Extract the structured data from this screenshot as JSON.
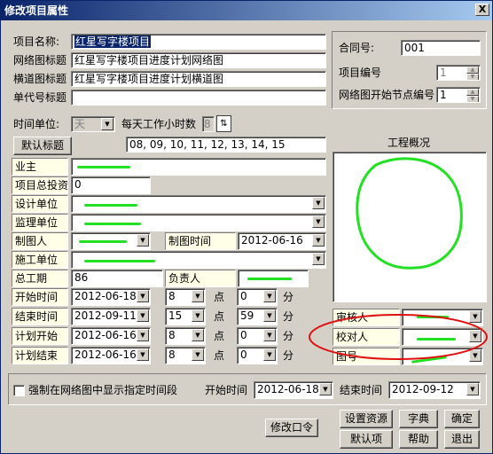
{
  "window": {
    "title": "修改项目属性",
    "close": "X"
  },
  "project": {
    "name_label": "项目名称:",
    "name_value": "红星写字楼项目",
    "network_title_label": "网络图标题",
    "network_title_value": "红星写字楼项目进度计划网络图",
    "gantt_title_label": "横道图标题",
    "gantt_title_value": "红星写字楼项目进度计划横道图",
    "unit_title_label": "单代号标题",
    "unit_title_value": ""
  },
  "right_panel": {
    "contract_label": "合同号:",
    "contract_value": "001",
    "proj_no_label": "项目编号",
    "proj_no_value": "1",
    "start_node_label": "网络图开始节点编号",
    "start_node_value": "1"
  },
  "time": {
    "unit_label": "时间单位:",
    "unit_value": "天",
    "hours_label": "每天工作小时数",
    "hours_value": "8"
  },
  "default_title_button": "默认标题",
  "hours_list": "08, 09, 10, 11, 12, 13, 14, 15",
  "fields": {
    "owner": "业主",
    "investment": "项目总投资",
    "investment_value": "0",
    "design": "设计单位",
    "supervise": "监理单位",
    "drafter": "制图人",
    "draw_time": "制图时间",
    "draw_time_value": "2012-06-16",
    "construct": "施工单位",
    "duration": "总工期",
    "duration_value": "86",
    "manager": "负责人",
    "start": "开始时间",
    "start_date": "2012-06-18",
    "start_h": "8",
    "start_m": "0",
    "end": "结束时间",
    "end_date": "2012-09-11",
    "end_h": "15",
    "end_m": "59",
    "plan_start": "计划开始",
    "plan_start_date": "2012-06-16",
    "plan_start_h": "8",
    "plan_start_m": "0",
    "plan_end": "计划结束",
    "plan_end_date": "2012-06-16",
    "plan_end_h": "8",
    "plan_end_m": "0",
    "point": "点",
    "minute": "分"
  },
  "overview": {
    "title": "工程概况"
  },
  "approval": {
    "reviewer": "审核人",
    "checker": "校对人",
    "drawing_no": "图号"
  },
  "force": {
    "label": "强制在网络图中显示指定时间段",
    "start_label": "开始时间",
    "start_value": "2012-06-18",
    "end_label": "结束时间",
    "end_value": "2012-09-12"
  },
  "buttons": {
    "change_pwd": "修改口令",
    "settings": "设置资源",
    "dict": "字典",
    "ok": "确定",
    "defaults": "默认项",
    "help": "帮助",
    "exit": "退出"
  }
}
